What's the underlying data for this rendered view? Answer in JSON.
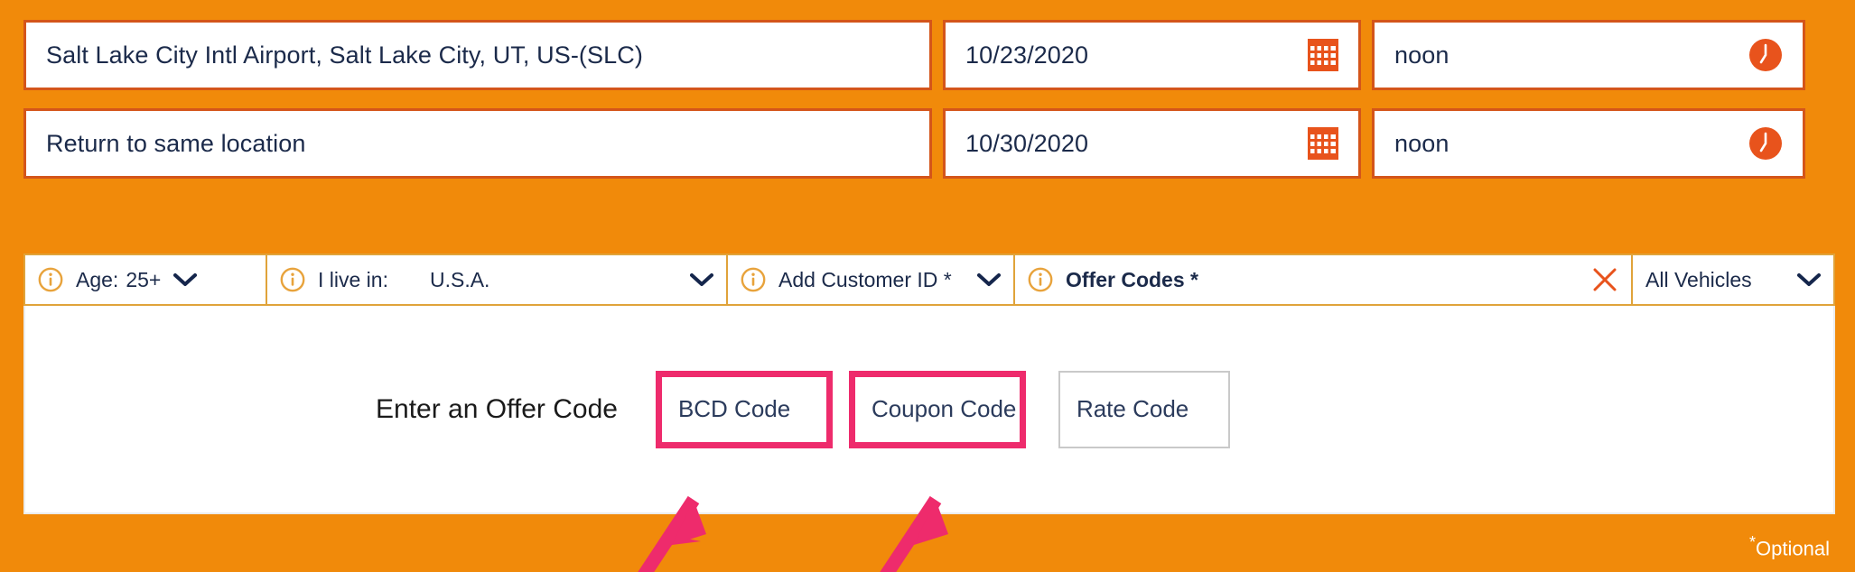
{
  "theme": {
    "background_orange": "#F18A0A",
    "field_border_orange": "#D4551A",
    "options_border": "#E0A33A",
    "text_navy": "#1B2A4A",
    "highlight_pink": "#EE2B6C",
    "rate_box_border": "#C9C9C9"
  },
  "search": {
    "pickup": {
      "location_value": "Salt Lake City Intl Airport, Salt Lake City, UT, US-(SLC)",
      "date_value": "10/23/2020",
      "time_value": "noon",
      "calendar_icon": "calendar-icon",
      "clock_icon": "clock-icon"
    },
    "return": {
      "location_value": "Return to same location",
      "date_value": "10/30/2020",
      "time_value": "noon",
      "calendar_icon": "calendar-icon",
      "clock_icon": "clock-icon"
    }
  },
  "options_bar": {
    "age": {
      "info_icon": "info-icon",
      "label": "Age:",
      "value": "25+",
      "chevron": "chevron-down-icon"
    },
    "live_in": {
      "info_icon": "info-icon",
      "label": "I live in:",
      "value": "U.S.A.",
      "chevron": "chevron-down-icon"
    },
    "customer_id": {
      "info_icon": "info-icon",
      "label": "Add Customer ID *",
      "chevron": "chevron-down-icon"
    },
    "offer_codes": {
      "info_icon": "info-icon",
      "label": "Offer Codes *",
      "close_icon": "close-x-icon"
    },
    "vehicles": {
      "label": "All Vehicles",
      "chevron": "chevron-down-icon"
    }
  },
  "offer_panel": {
    "prompt": "Enter an Offer Code",
    "bcd_placeholder": "BCD Code",
    "coupon_placeholder": "Coupon Code",
    "rate_placeholder": "Rate Code"
  },
  "footer": {
    "optional_star": "*",
    "optional_label": "Optional"
  },
  "annotations": {
    "arrow_color": "#EE2B6C",
    "arrow_1_target": "bcd-code-input",
    "arrow_2_target": "coupon-code-input"
  }
}
